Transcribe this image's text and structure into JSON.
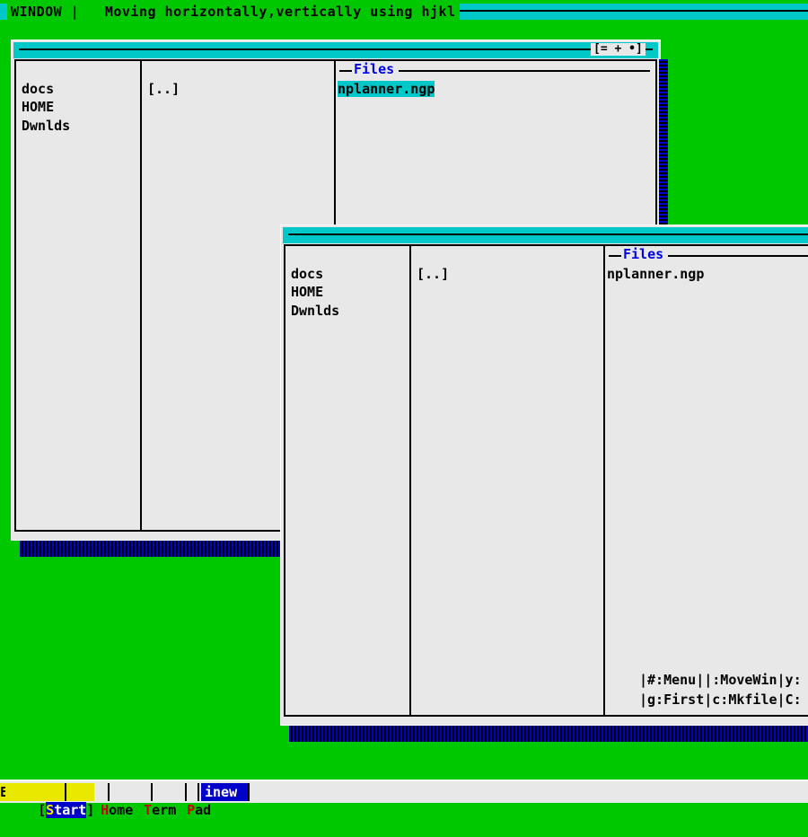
{
  "topbar": {
    "label": "WINDOW |   Moving horizontally,vertically using hjkl"
  },
  "window_back": {
    "controls": "[= + •]",
    "places": [
      "docs",
      "HOME",
      "Dwnlds"
    ],
    "dirs": [
      "[..]"
    ],
    "files_title": "Files",
    "files": [
      "nplanner.ngp"
    ]
  },
  "window_front": {
    "places": [
      "docs",
      "HOME",
      "Dwnlds"
    ],
    "dirs": [
      "[..]"
    ],
    "files_title": "Files",
    "files": [
      "nplanner.ngp"
    ],
    "hint_line1": "|#:Menu||:MoveWin|y:",
    "hint_line2": "|g:First|c:Mkfile|C:"
  },
  "taskbar": {
    "lead": "E",
    "start_open": "[",
    "start_s": "S",
    "start_rest": "tart",
    "start_close": "]",
    "items": [
      {
        "hot": "H",
        "rest": "ome"
      },
      {
        "hot": "T",
        "rest": "erm"
      },
      {
        "hot": "P",
        "rest": "ad"
      }
    ],
    "active": "inew"
  },
  "colors": {
    "desktop": "#00c800",
    "titlebar": "#00c8c8",
    "panel": "#e8e8e8",
    "files_title": "#0000e0",
    "hotkey": "#c80000",
    "task_active": "#0000c8",
    "start_bg": "#0000c8"
  }
}
